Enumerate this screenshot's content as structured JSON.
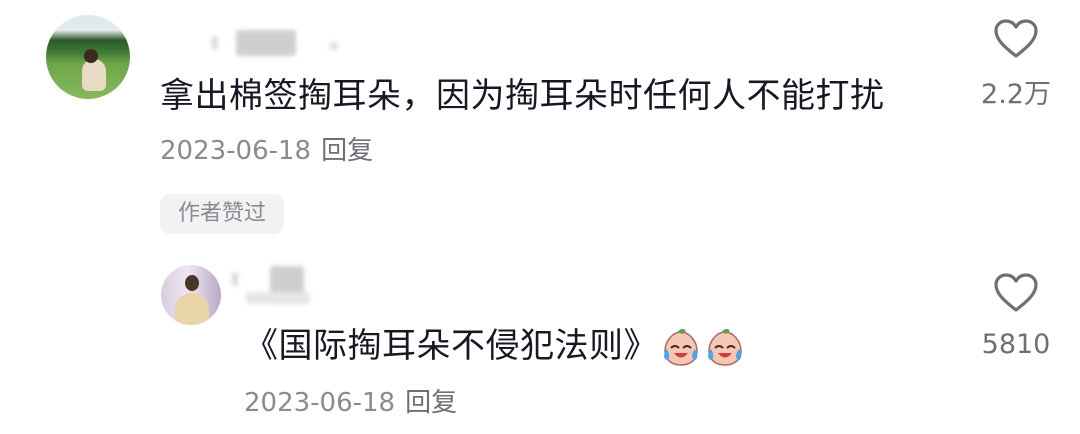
{
  "comments": [
    {
      "text": "拿出棉签掏耳朵，因为掏耳朵时任何人不能打扰",
      "date": "2023-06-18",
      "reply_label": "回复",
      "likes": "2.2万",
      "badge": "作者赞过"
    },
    {
      "text": "《国际掏耳朵不侵犯法则》",
      "date": "2023-06-18",
      "reply_label": "回复",
      "likes": "5810",
      "emojis": [
        "crying-laugh-emoji",
        "crying-laugh-emoji"
      ]
    }
  ],
  "icons": {
    "like": "heart-outline-icon"
  },
  "colors": {
    "text": "#161823",
    "meta": "#8a8b91",
    "badge_bg": "#f2f2f4",
    "icon": "#6f7076"
  }
}
